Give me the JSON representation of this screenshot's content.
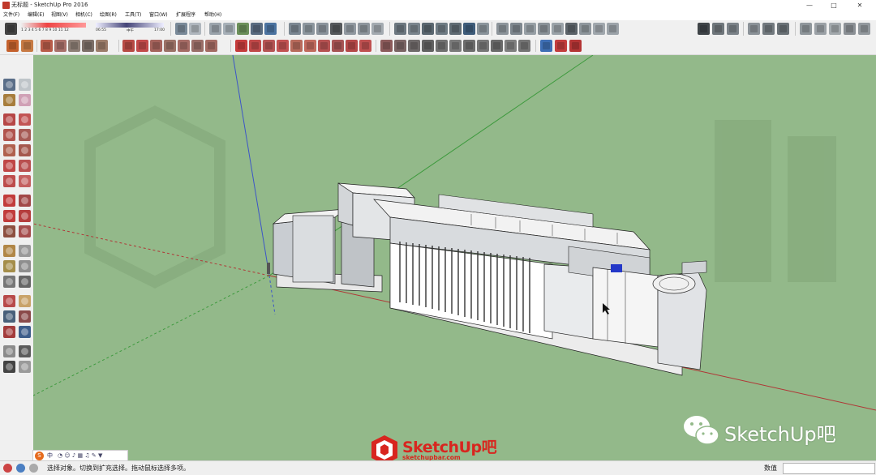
{
  "window": {
    "title": "无标题 - SketchUp Pro 2016",
    "controls": [
      "—",
      "□",
      "✕"
    ]
  },
  "menu": {
    "items": [
      "文件(F)",
      "编辑(E)",
      "视图(V)",
      "相机(C)",
      "绘图(R)",
      "工具(T)",
      "窗口(W)",
      "扩展程序",
      "帮助(H)"
    ]
  },
  "shadow": {
    "ticks": "1 2 3 4 5 6 7 8 9 10 11 12",
    "time_start": "06:55",
    "time_mid": "中午",
    "time_end": "17:00"
  },
  "status": {
    "message": "选择对象。切换到扩充选择。拖动鼠标选择多项。",
    "measure_label": "数值",
    "measure_value": ""
  },
  "ime": {
    "label": "中"
  },
  "watermark": {
    "brand": "SketchUp吧",
    "url": "sketchupbar.com"
  },
  "wechat": {
    "label": "SketchUp吧"
  },
  "colors": {
    "viewport_bg": "#93b98a",
    "brand_red": "#d8261f"
  }
}
